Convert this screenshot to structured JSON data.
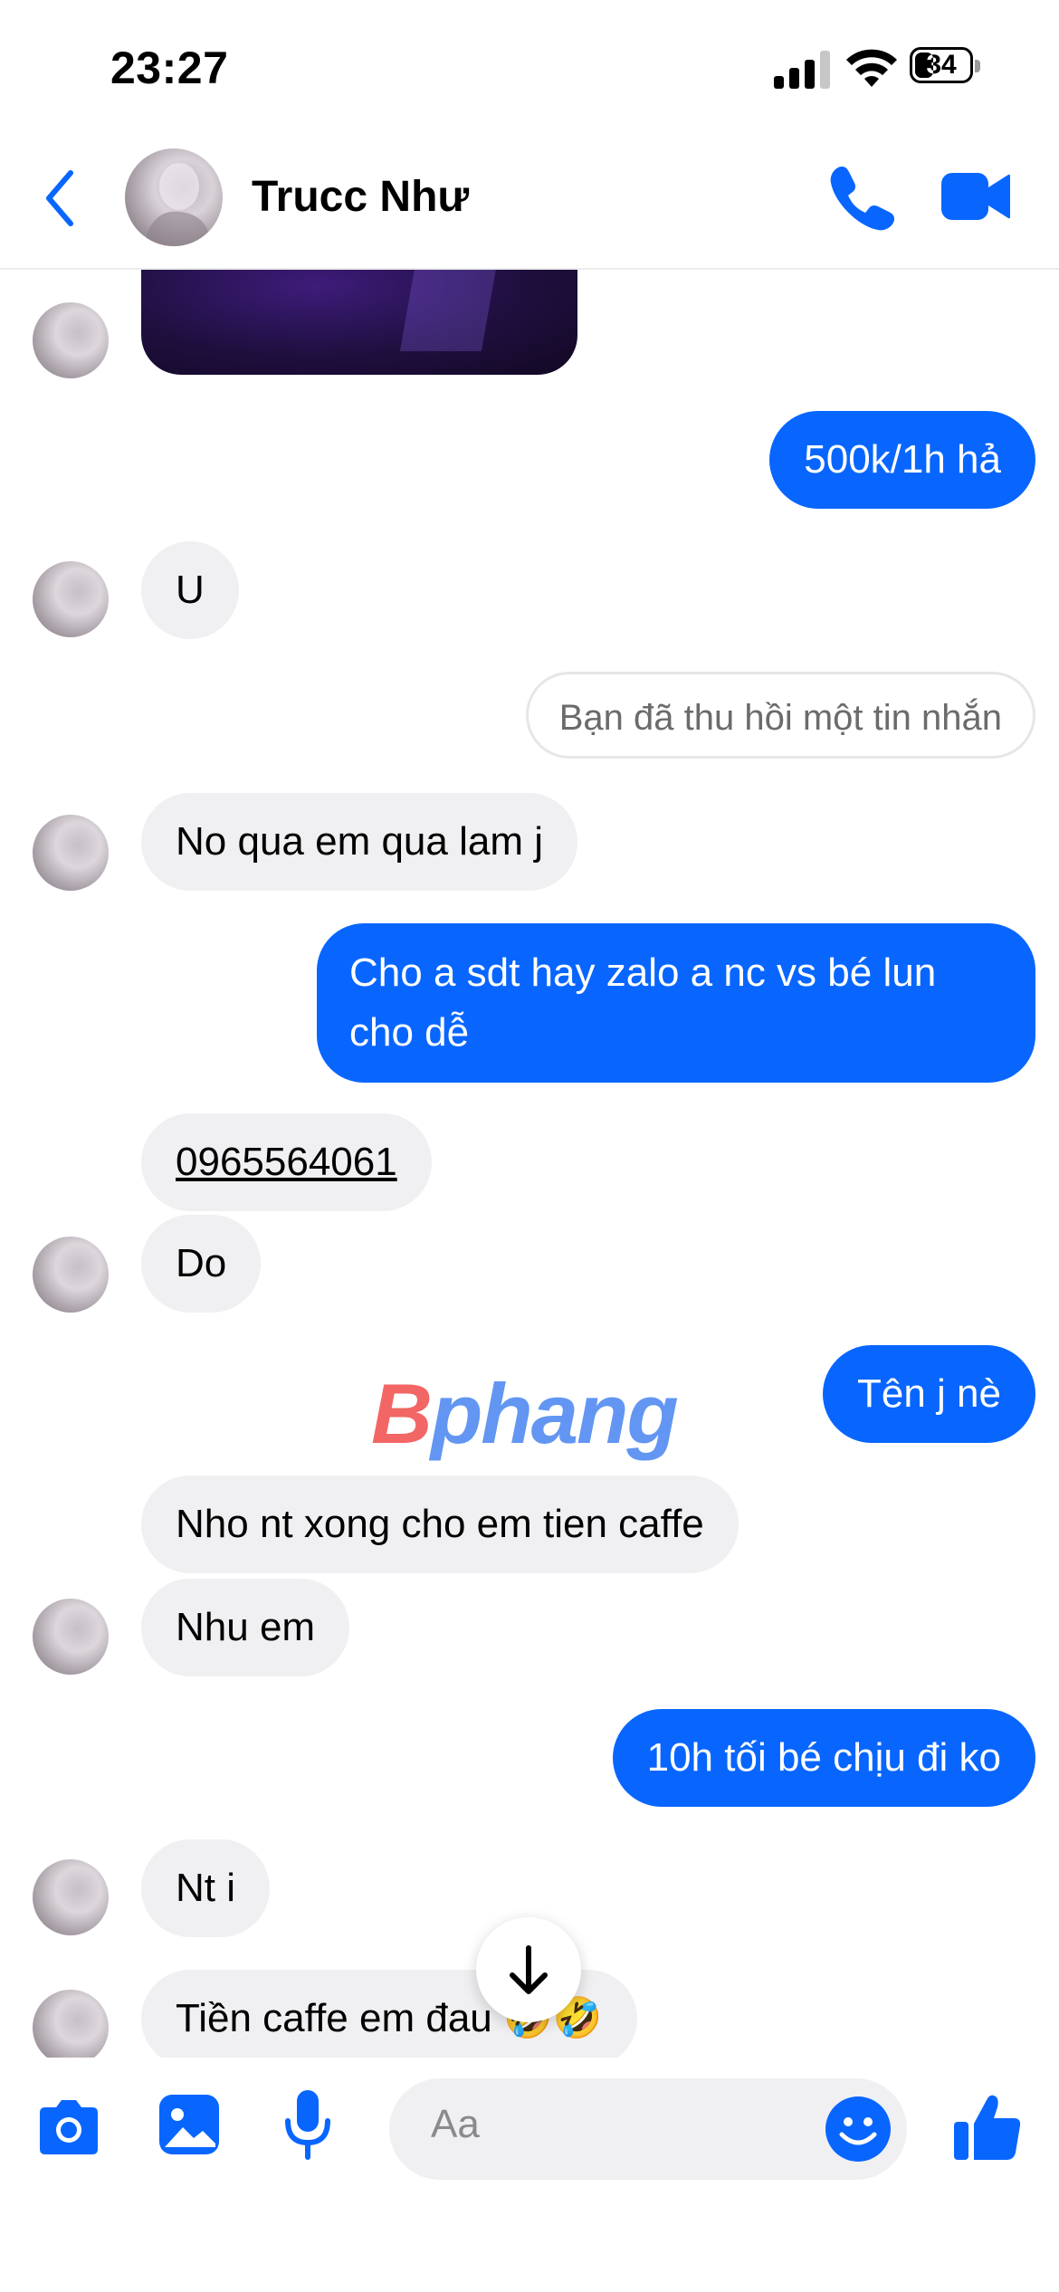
{
  "status_bar": {
    "time": "23:27",
    "battery": "34",
    "battery_level_pct": 34
  },
  "header": {
    "contact_name": "Trucc Như"
  },
  "messages": {
    "m1": "500k/1h hả",
    "m2": "U",
    "m3": "Bạn đã thu hồi một tin nhắn",
    "m4": "No qua em qua lam j",
    "m5": "Cho a sdt hay zalo a nc vs bé lun cho dễ",
    "m6": "0965564061",
    "m7": "Do",
    "m8": "Tên j nè",
    "m9": "Nho nt xong cho em tien caffe",
    "m10": "Nhu em",
    "m11": "10h tối bé chịu đi ko",
    "m12": "Nt i",
    "m13": "Tiền caffe em đau 🤣🤣"
  },
  "watermark": {
    "part1": "B",
    "part2": "phang"
  },
  "composer": {
    "placeholder": "Aa"
  },
  "colors": {
    "accent": "#0866ff",
    "incoming_bubble": "#f0f0f2",
    "outgoing_bubble": "#0866ff"
  },
  "icons": [
    "back-chevron-icon",
    "phone-icon",
    "video-camera-icon",
    "arrow-down-icon",
    "camera-icon",
    "image-icon",
    "microphone-icon",
    "emoji-icon",
    "thumbs-up-icon"
  ]
}
